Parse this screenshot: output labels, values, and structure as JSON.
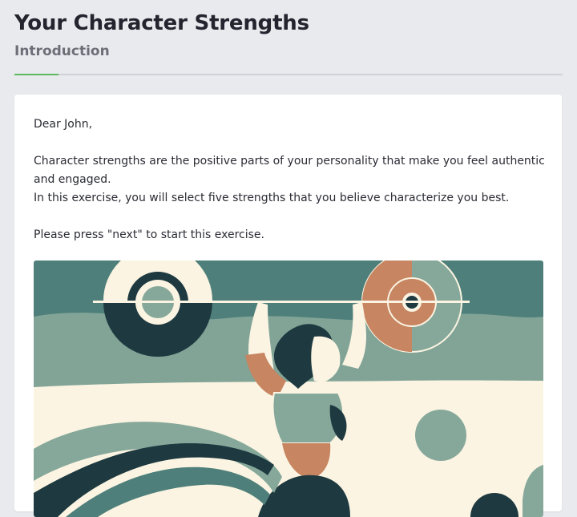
{
  "header": {
    "title": "Your Character Strengths",
    "subtitle": "Introduction",
    "progress_fraction": 0.08
  },
  "content": {
    "greeting": "Dear John,",
    "paragraph1": "Character strengths are the positive parts of your personality that make you feel authentic and engaged.",
    "paragraph2": "In this exercise, you will select five strengths that you believe characterize you best.",
    "paragraph3": "Please press \"next\" to start this exercise."
  },
  "illustration": {
    "icon": "weightlifter-illustration",
    "colors": {
      "teal": "#4f7f7a",
      "sage": "#86a89a",
      "cream": "#fbf4e2",
      "navy": "#1e3a40",
      "terracotta": "#c78562"
    }
  },
  "theme": {
    "background": "#e9eaee",
    "accent": "#5cb85c"
  }
}
